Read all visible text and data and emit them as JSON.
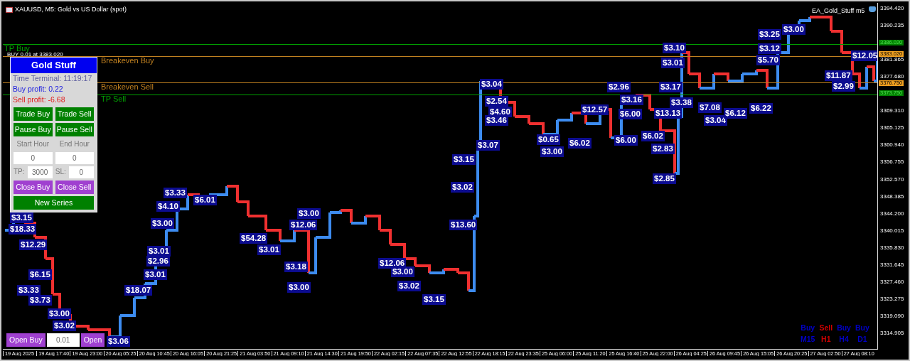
{
  "chart": {
    "title": "XAUUSD, M5:  Gold vs US Dollar (spot)",
    "expert": "EA_Gold_Stuff m5",
    "price_axis": [
      "3394.420",
      "3390.235",
      "3381.865",
      "3377.680",
      "3369.310",
      "3365.125",
      "3360.940",
      "3356.755",
      "3352.570",
      "3348.385",
      "3344.200",
      "3340.015",
      "3335.830",
      "3331.645",
      "3327.460",
      "3323.275",
      "3319.090",
      "3314.905"
    ],
    "price_markers": [
      {
        "text": "3386.020",
        "kind": "tp"
      },
      {
        "text": "3383.020",
        "kind": "entry"
      },
      {
        "text": "3376.750",
        "kind": "breakeven"
      },
      {
        "text": "3373.750",
        "kind": "tp"
      }
    ],
    "level_lines": [
      {
        "label": "TP Buy",
        "kind": "tp"
      },
      {
        "label": "Breakeven Buy",
        "kind": "breakeven"
      },
      {
        "label": "Breakeven Sell",
        "kind": "breakeven"
      },
      {
        "label": "TP Sell",
        "kind": "tp"
      }
    ],
    "order_label": "BUY 0.01 at 3383.020",
    "trade_labels": [
      "$3.15",
      "$18.33",
      "$12.29",
      "$6.15",
      "$3.33",
      "$3.73",
      "$3.00",
      "$3.02",
      "$3.06",
      "$18.07",
      "$3.33",
      "$4.10",
      "$3.00",
      "$3.01",
      "$2.96",
      "$3.01",
      "$6.01",
      "$54.28",
      "$3.01",
      "$3.18",
      "$3.00",
      "$3.00",
      "$12.06",
      "$12.06",
      "$3.00",
      "$3.02",
      "$3.15",
      "$3.15",
      "$3.02",
      "$13.60",
      "$3.04",
      "$2.54",
      "$4.60",
      "$3.46",
      "$3.07",
      "$0.65",
      "$3.00",
      "$6.02",
      "$12.57",
      "$2.96",
      "$3.16",
      "$6.00",
      "$6.00",
      "$3.10",
      "$3.01",
      "$3.17",
      "$3.38",
      "$13.13",
      "$7.08",
      "$6.02",
      "$2.83",
      "$2.85",
      "$3.04",
      "$6.12",
      "$6.22",
      "$3.25",
      "$3.12",
      "$5.70",
      "$3.00",
      "$12.05",
      "$11.87",
      "$2.99"
    ],
    "time_axis": [
      "19 Aug 2025",
      "19 Aug 17:40",
      "19 Aug 23:00",
      "20 Aug 05:25",
      "20 Aug 10:45",
      "20 Aug 16:05",
      "20 Aug 21:25",
      "21 Aug 03:50",
      "21 Aug 09:10",
      "21 Aug 14:30",
      "21 Aug 19:50",
      "22 Aug 02:15",
      "22 Aug 07:35",
      "22 Aug 12:55",
      "22 Aug 18:15",
      "22 Aug 23:35",
      "25 Aug 06:00",
      "25 Aug 11:20",
      "25 Aug 16:40",
      "25 Aug 22:00",
      "26 Aug 04:25",
      "26 Aug 09:45",
      "26 Aug 15:05",
      "26 Aug 20:25",
      "27 Aug 02:50",
      "27 Aug 08:10"
    ]
  },
  "panel": {
    "title": "Gold Stuff",
    "info": [
      {
        "text": "Time Terminal: 11:19:17",
        "kind": "time"
      },
      {
        "text": "Buy profit: 0.22",
        "kind": "buy"
      },
      {
        "text": "Sell profit: -6.68",
        "kind": "sell"
      }
    ],
    "trade_buttons": [
      "Trade Buy",
      "Trade Sell"
    ],
    "pause_buttons": [
      "Pause Buy",
      "Pause Sell"
    ],
    "hour_labels": [
      "Start Hour",
      "End Hour"
    ],
    "hour_values": [
      "0",
      "0"
    ],
    "tp_label": "TP:",
    "tp_value": "3000",
    "sl_label": "SL:",
    "sl_value": "0",
    "close_buttons": [
      "Close Buy",
      "Close Sell"
    ],
    "series_button": "New Series"
  },
  "quick_trade": {
    "buttons": [
      "Open Buy",
      "Open"
    ],
    "lot": "0.01"
  },
  "signals": [
    {
      "direction": "Buy",
      "timeframe": "M15",
      "color": "#0000c8"
    },
    {
      "direction": "Sell",
      "timeframe": "H1",
      "color": "#d00000"
    },
    {
      "direction": "Buy",
      "timeframe": "H4",
      "color": "#0000c8"
    },
    {
      "direction": "Buy",
      "timeframe": "D1",
      "color": "#0000c8"
    }
  ]
}
